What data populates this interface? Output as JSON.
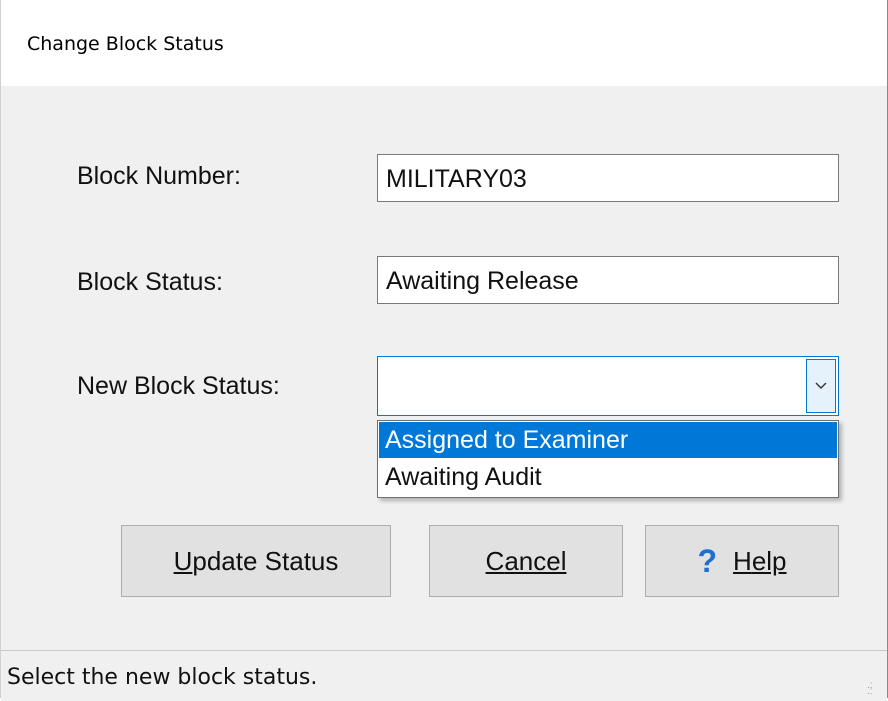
{
  "window": {
    "title": "Change Block Status"
  },
  "form": {
    "block_number_label": "Block Number:",
    "block_number_value": "MILITARY03",
    "block_status_label": "Block Status:",
    "block_status_value": "Awaiting Release",
    "new_status_label": "New Block Status:",
    "new_status_value": "",
    "new_status_options": [
      "Assigned to Examiner",
      "Awaiting Audit"
    ],
    "highlighted_option": "Assigned to Examiner"
  },
  "buttons": {
    "update": {
      "mnemonic": "U",
      "rest": "pdate Status"
    },
    "cancel": {
      "mnemonic": "C",
      "rest": "ancel"
    },
    "help": {
      "icon": "?",
      "mnemonic": "H",
      "rest": "elp"
    }
  },
  "status_bar": {
    "text": "Select the new block status."
  },
  "colors": {
    "selection": "#0078d7",
    "help_icon": "#1e6fd0"
  }
}
